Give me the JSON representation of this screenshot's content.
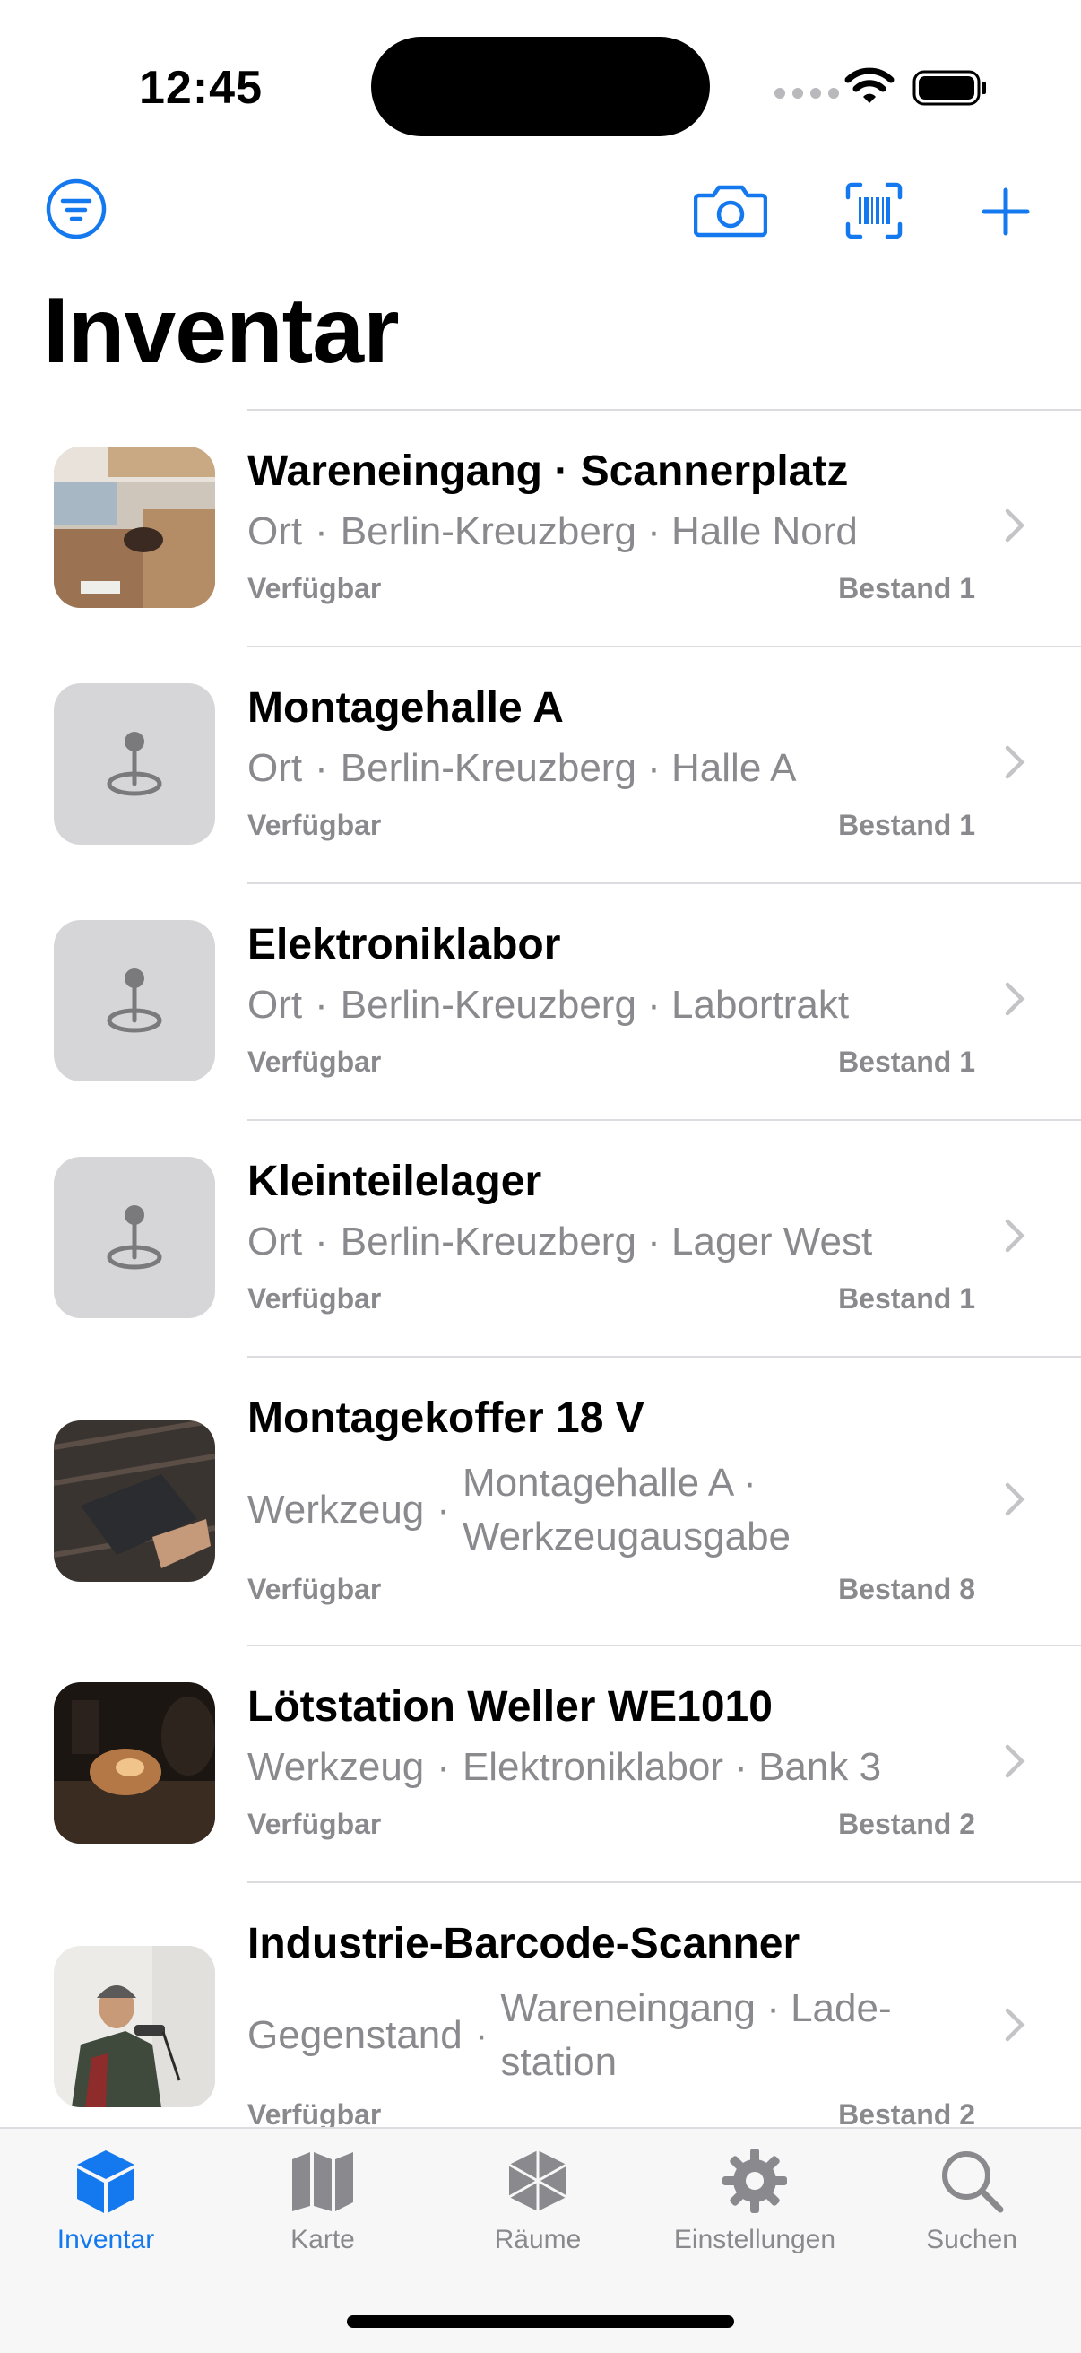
{
  "status_bar": {
    "time": "12:45"
  },
  "header": {
    "title": "Inventar"
  },
  "toolbar": {
    "filter_icon": "filter-circle-icon",
    "camera_icon": "camera-icon",
    "scan_icon": "barcode-viewfinder-icon",
    "add_icon": "plus-icon",
    "accent_color": "#1479EE"
  },
  "items": [
    {
      "name": "Wareneingang · Scannerplatz",
      "kind": "Ort",
      "location": "Berlin-Kreuzberg · Halle Nord",
      "status": "Verfügbar",
      "stock": "Bestand 1",
      "thumbnail": "photo-boxes"
    },
    {
      "name": "Montagehalle A",
      "kind": "Ort",
      "location": "Berlin-Kreuzberg · Halle A",
      "status": "Verfügbar",
      "stock": "Bestand 1",
      "thumbnail": "location-pin-icon"
    },
    {
      "name": "Elektroniklabor",
      "kind": "Ort",
      "location": "Berlin-Kreuzberg · Labortrakt",
      "status": "Verfügbar",
      "stock": "Bestand 1",
      "thumbnail": "location-pin-icon"
    },
    {
      "name": "Kleinteilelager",
      "kind": "Ort",
      "location": "Berlin-Kreuzberg · Lager West",
      "status": "Verfügbar",
      "stock": "Bestand 1",
      "thumbnail": "location-pin-icon"
    },
    {
      "name": "Montagekoffer 18 V",
      "kind": "Werkzeug",
      "location": "Montagehalle A · Werkzeugausgabe",
      "status": "Verfügbar",
      "stock": "Bestand 8",
      "thumbnail": "photo-tool-case"
    },
    {
      "name": "Lötstation Weller WE1010",
      "kind": "Werkzeug",
      "location": "Elektroniklabor · Bank 3",
      "status": "Verfügbar",
      "stock": "Bestand 2",
      "thumbnail": "photo-soldering"
    },
    {
      "name": "Industrie-Barcode-Scanner",
      "kind": "Gegenstand",
      "location": "Wareneingang · Lade-station",
      "status": "Verfügbar",
      "stock": "Bestand 2",
      "thumbnail": "photo-scanner-worker"
    }
  ],
  "tabs": [
    {
      "label": "Inventar",
      "icon": "cube-icon",
      "active": true
    },
    {
      "label": "Karte",
      "icon": "map-icon",
      "active": false
    },
    {
      "label": "Räume",
      "icon": "rooms-icon",
      "active": false
    },
    {
      "label": "Einstellungen",
      "icon": "gear-icon",
      "active": false
    },
    {
      "label": "Suchen",
      "icon": "search-icon",
      "active": false
    }
  ]
}
